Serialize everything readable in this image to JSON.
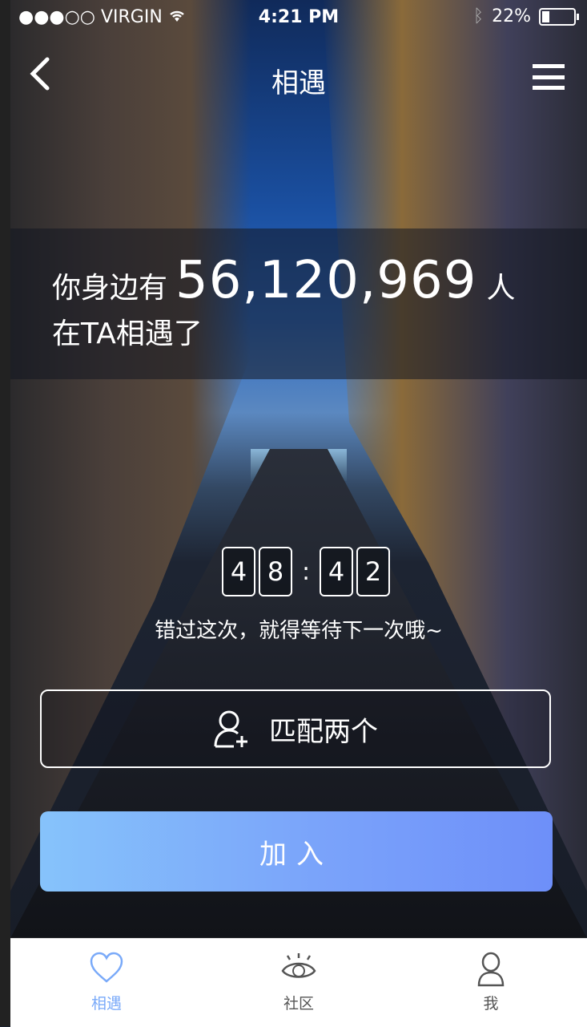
{
  "status_bar": {
    "carrier": "VIRGIN",
    "time": "4:21 PM",
    "battery": "22%"
  },
  "nav": {
    "title": "相遇"
  },
  "banner": {
    "prefix": "你身边有",
    "count": "56,120,969",
    "suffix": "人",
    "line2": "在TA相遇了"
  },
  "countdown": {
    "digits": [
      "4",
      "8",
      "4",
      "2"
    ],
    "separator": ":"
  },
  "hint": "错过这次，就得等待下一次哦~",
  "match_button": {
    "label": "匹配两个"
  },
  "join_button": {
    "label": "加入"
  },
  "tabs": [
    {
      "label": "相遇",
      "icon": "heart-icon",
      "active": true
    },
    {
      "label": "社区",
      "icon": "eye-icon",
      "active": false
    },
    {
      "label": "我",
      "icon": "user-icon",
      "active": false
    }
  ],
  "colors": {
    "accent": "#7aaaf9",
    "tab_inactive": "#555555",
    "button_gradient_start": "#86c3fb",
    "button_gradient_end": "#6e8ff9"
  }
}
